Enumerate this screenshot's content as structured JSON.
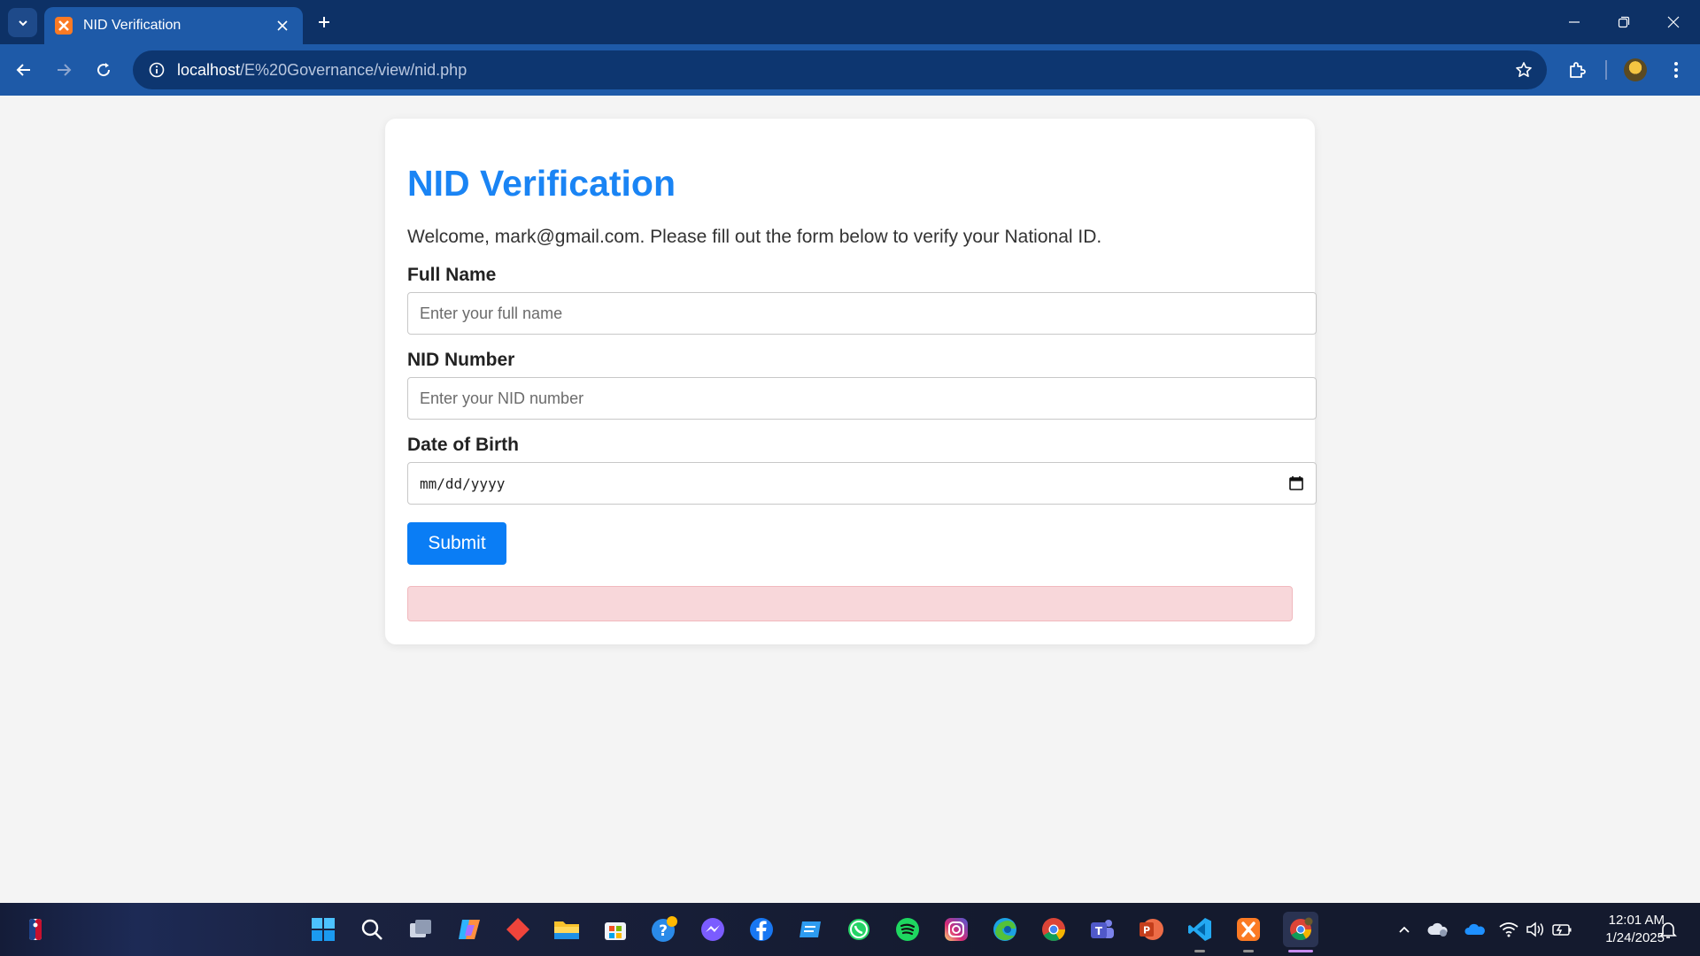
{
  "browser": {
    "tab_title": "NID Verification",
    "url_host": "localhost",
    "url_path": "/E%20Governance/view/nid.php"
  },
  "page": {
    "title": "NID Verification",
    "welcome": "Welcome, mark@gmail.com. Please fill out the form below to verify your National ID.",
    "fields": {
      "full_name": {
        "label": "Full Name",
        "placeholder": "Enter your full name"
      },
      "nid_number": {
        "label": "NID Number",
        "placeholder": "Enter your NID number"
      },
      "dob": {
        "label": "Date of Birth",
        "placeholder": "mm/dd/yyyy"
      }
    },
    "submit_label": "Submit"
  },
  "taskbar": {
    "time": "12:01 AM",
    "date": "1/24/2025"
  },
  "colors": {
    "accent": "#1a84f4",
    "button": "#0a7df5",
    "alert_bg": "#f8d7da",
    "chrome_dark": "#0d3166",
    "chrome_toolbar": "#1e5aa8"
  },
  "icons": {
    "tabstrip": [
      "tab-search-icon",
      "xampp-favicon-icon",
      "close-icon",
      "plus-icon",
      "minimize-icon",
      "restore-icon",
      "window-close-icon"
    ],
    "toolbar": [
      "back-icon",
      "forward-icon",
      "reload-icon",
      "site-info-icon",
      "bookmark-star-icon",
      "extensions-icon",
      "profile-avatar",
      "menu-icon"
    ],
    "taskbar": [
      "nba-widget-icon",
      "windows-start-icon",
      "search-icon",
      "task-view-icon",
      "copilot-icon",
      "anydesk-icon",
      "file-explorer-icon",
      "store-icon",
      "help-icon",
      "messenger-icon",
      "facebook-icon",
      "notes-icon",
      "whatsapp-icon",
      "spotify-icon",
      "instagram-icon",
      "edge-icon",
      "chrome-icon",
      "teams-icon",
      "powerpoint-icon",
      "vscode-icon",
      "xampp-icon",
      "chrome-profile-icon"
    ],
    "tray": [
      "chevron-up-icon",
      "network-cloud-icon",
      "onedrive-icon",
      "wifi-icon",
      "volume-icon",
      "battery-icon",
      "notification-icon"
    ]
  }
}
